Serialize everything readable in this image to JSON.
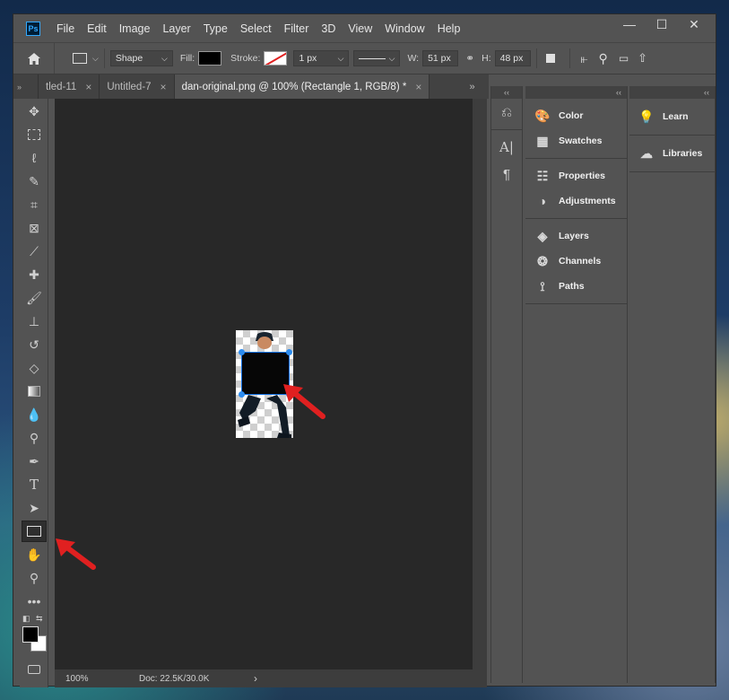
{
  "app": {
    "logo": "Ps"
  },
  "menu": [
    "File",
    "Edit",
    "Image",
    "Layer",
    "Type",
    "Select",
    "Filter",
    "3D",
    "View",
    "Window",
    "Help"
  ],
  "window_controls": {
    "minimize": "—",
    "maximize": "☐",
    "close": "✕"
  },
  "options": {
    "mode": "Shape",
    "fill_label": "Fill:",
    "stroke_label": "Stroke:",
    "stroke_width": "1 px",
    "w_label": "W:",
    "w_value": "51 px",
    "h_label": "H:",
    "h_value": "48 px"
  },
  "tabs": [
    {
      "label": "tled-11",
      "close": "×"
    },
    {
      "label": "Untitled-7",
      "close": "×"
    },
    {
      "label": "dan-original.png @ 100% (Rectangle 1, RGB/8) *",
      "close": "×"
    }
  ],
  "status": {
    "zoom": "100%",
    "doc": "Doc: 22.5K/30.0K",
    "chevron": "›"
  },
  "panels": {
    "col1": [
      [
        {
          "icon": "palette-icon",
          "label": "Color"
        },
        {
          "icon": "swatches-icon",
          "label": "Swatches"
        }
      ],
      [
        {
          "icon": "properties-icon",
          "label": "Properties"
        },
        {
          "icon": "adjustments-icon",
          "label": "Adjustments"
        }
      ],
      [
        {
          "icon": "layers-icon",
          "label": "Layers"
        },
        {
          "icon": "channels-icon",
          "label": "Channels"
        },
        {
          "icon": "paths-icon",
          "label": "Paths"
        }
      ]
    ],
    "col2": [
      {
        "icon": "learn-icon",
        "label": "Learn"
      },
      {
        "icon": "libraries-icon",
        "label": "Libraries"
      }
    ]
  },
  "colors": {
    "foreground": "#000000",
    "background": "#ffffff",
    "accent": "#31a8ff",
    "annotation_arrow": "#e02020"
  }
}
